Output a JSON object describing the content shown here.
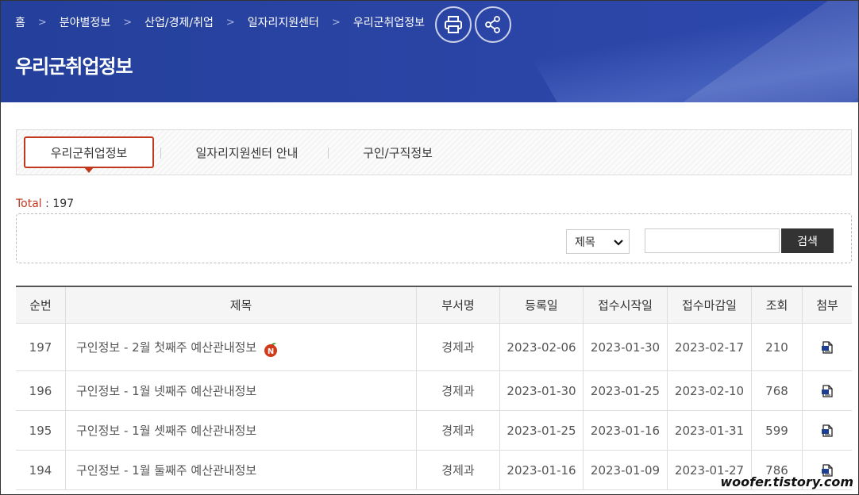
{
  "breadcrumb": [
    "홈",
    "분야별정보",
    "산업/경제/취업",
    "일자리지원센터",
    "우리군취업정보"
  ],
  "page_title": "우리군취업정보",
  "tabs": [
    "우리군취업정보",
    "일자리지원센터 안내",
    "구인/구직정보"
  ],
  "total": {
    "label": "Total",
    "value": "197"
  },
  "search": {
    "select_value": "제목",
    "input_value": "",
    "button_label": "검색"
  },
  "table": {
    "headers": [
      "순번",
      "제목",
      "부서명",
      "등록일",
      "접수시작일",
      "접수마감일",
      "조회",
      "첨부"
    ],
    "rows": [
      {
        "no": "197",
        "title": "구인정보 - 2월 첫째주 예산관내정보",
        "dept": "경제과",
        "reg": "2023-02-06",
        "start": "2023-01-30",
        "end": "2023-02-17",
        "views": "210",
        "new": true
      },
      {
        "no": "196",
        "title": "구인정보 - 1월 넷째주 예산관내정보",
        "dept": "경제과",
        "reg": "2023-01-30",
        "start": "2023-01-25",
        "end": "2023-02-10",
        "views": "768",
        "new": false
      },
      {
        "no": "195",
        "title": "구인정보 - 1월 셋째주 예산관내정보",
        "dept": "경제과",
        "reg": "2023-01-25",
        "start": "2023-01-16",
        "end": "2023-01-31",
        "views": "599",
        "new": false
      },
      {
        "no": "194",
        "title": "구인정보 - 1월 둘째주 예산관내정보",
        "dept": "경제과",
        "reg": "2023-01-16",
        "start": "2023-01-09",
        "end": "2023-01-27",
        "views": "786",
        "new": false
      }
    ]
  },
  "new_badge_text": "N",
  "watermark": "woofer.tistory.com",
  "colors": {
    "banner": "#2b45a6",
    "accent": "#c1381f",
    "search_button": "#333333"
  }
}
